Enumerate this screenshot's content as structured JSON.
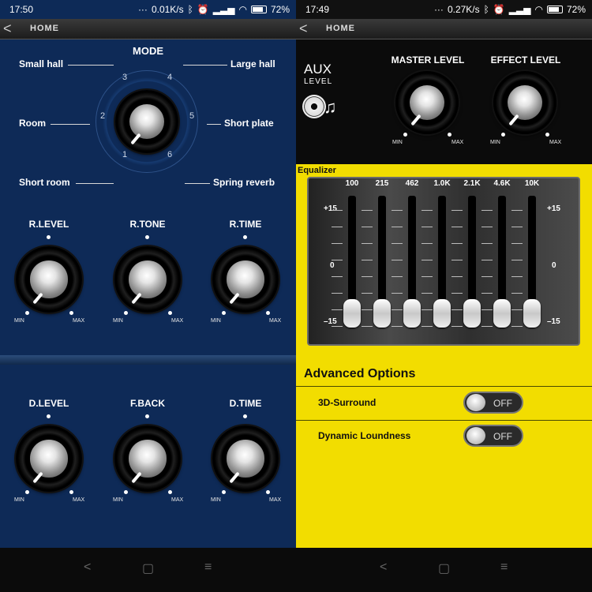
{
  "left": {
    "status": {
      "time": "17:50",
      "speed": "0.01K/s",
      "battery": "72%"
    },
    "topbar": {
      "back": "<",
      "title": "HOME"
    },
    "mode": {
      "title": "MODE",
      "labels": [
        "Small hall",
        "Large hall",
        "Room",
        "Short plate",
        "Short room",
        "Spring reverb"
      ],
      "numbers": [
        "1",
        "2",
        "3",
        "4",
        "5",
        "6"
      ],
      "selected": "1"
    },
    "knobs": [
      {
        "title": "R.LEVEL",
        "min": "MIN",
        "max": "MAX"
      },
      {
        "title": "R.TONE",
        "min": "MIN",
        "max": "MAX"
      },
      {
        "title": "R.TIME",
        "min": "MIN",
        "max": "MAX"
      },
      {
        "title": "D.LEVEL",
        "min": "MIN",
        "max": "MAX"
      },
      {
        "title": "F.BACK",
        "min": "MIN",
        "max": "MAX"
      },
      {
        "title": "D.TIME",
        "min": "MIN",
        "max": "MAX"
      }
    ],
    "nav": {
      "back": "<",
      "home": "▢",
      "menu": "≡"
    }
  },
  "right": {
    "status": {
      "time": "17:49",
      "speed": "0.27K/s",
      "battery": "72%"
    },
    "topbar": {
      "back": "<",
      "title": "HOME"
    },
    "aux": {
      "title": "AUX",
      "subtitle": "LEVEL"
    },
    "level_knobs": [
      {
        "title": "MASTER LEVEL",
        "min": "MIN",
        "max": "MAX"
      },
      {
        "title": "EFFECT LEVEL",
        "min": "MIN",
        "max": "MAX"
      }
    ],
    "equalizer": {
      "label": "Equalizer",
      "bands": [
        "100",
        "215",
        "462",
        "1.0K",
        "2.1K",
        "4.6K",
        "10K"
      ],
      "scale_top": "+15",
      "scale_mid": "0",
      "scale_bottom": "–15",
      "levels": [
        -15,
        -15,
        -15,
        -15,
        -15,
        -15,
        -15
      ]
    },
    "advanced": {
      "title": "Advanced Options",
      "options": [
        {
          "label": "3D-Surround",
          "state": "OFF"
        },
        {
          "label": "Dynamic Loundness",
          "state": "OFF"
        }
      ]
    },
    "nav": {
      "back": "<",
      "home": "▢",
      "menu": "≡"
    }
  },
  "colors": {
    "panel_blue": "#0e2a57",
    "eq_yellow": "#f2dd00",
    "dark": "#0b0b0b"
  }
}
